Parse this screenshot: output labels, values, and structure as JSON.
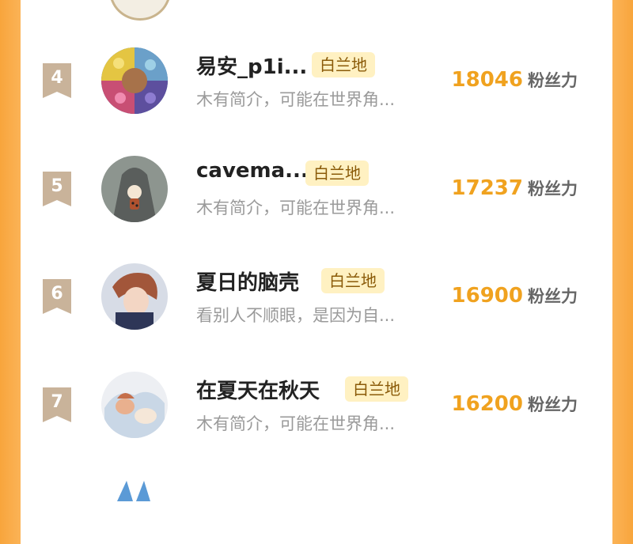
{
  "ranking": {
    "fans_label": "粉丝力",
    "items": [
      {
        "rank": "4",
        "name": "易安_p1i...",
        "badge": "白兰地",
        "bio": "木有简介，可能在世界角...",
        "fans": "18046"
      },
      {
        "rank": "5",
        "name": "cavema...",
        "badge": "白兰地",
        "bio": "木有简介，可能在世界角...",
        "fans": "17237"
      },
      {
        "rank": "6",
        "name": "夏日的脑壳",
        "badge": "白兰地",
        "bio": "看别人不顺眼，是因为自...",
        "fans": "16900"
      },
      {
        "rank": "7",
        "name": "在夏天在秋天",
        "badge": "白兰地",
        "bio": "木有简介，可能在世界角...",
        "fans": "16200"
      }
    ]
  },
  "colors": {
    "accent": "#F0A21F",
    "rank_flag": "#C9B39A",
    "badge_bg": "#FFF1C2",
    "side": "#F8A53C"
  }
}
